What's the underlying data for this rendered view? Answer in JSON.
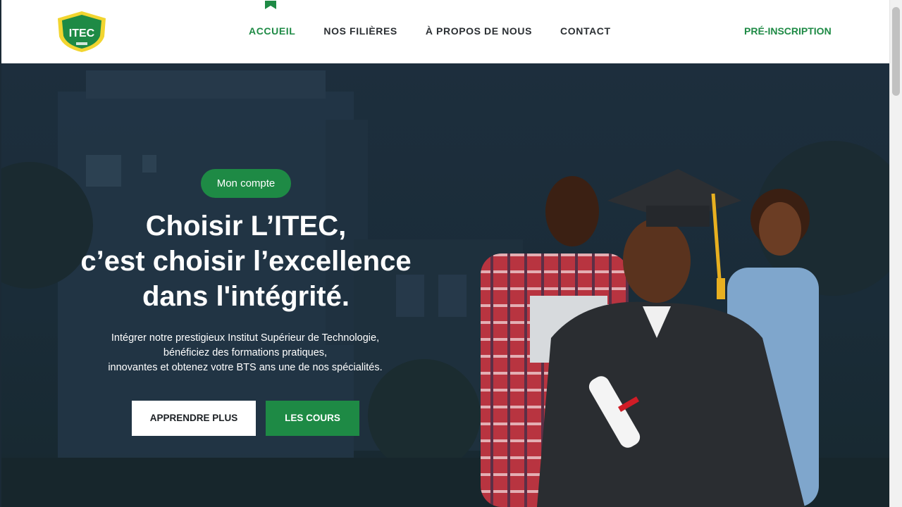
{
  "header": {
    "logo_text": "ITEC",
    "nav": [
      {
        "label": "ACCUEIL",
        "active": true
      },
      {
        "label": "NOS FILIÈRES",
        "active": false
      },
      {
        "label": "À PROPOS DE NOUS",
        "active": false
      },
      {
        "label": "CONTACT",
        "active": false
      }
    ],
    "preinscription_label": "PRÉ-INSCRIPTION"
  },
  "hero": {
    "account_button": "Mon compte",
    "headline": [
      "Choisir L’ITEC,",
      "c’est choisir l’excellence",
      "dans l'intégrité."
    ],
    "subtext": [
      "Intégrer notre prestigieux Institut Supérieur de Technologie,",
      "bénéficiez des formations pratiques,",
      "innovantes et obtenez votre BTS ans une de nos spécialités."
    ],
    "primary_button": "APPRENDRE PLUS",
    "secondary_button": "LES COURS"
  },
  "colors": {
    "accent_green": "#1e8a45",
    "logo_yellow": "#f2d530",
    "hero_overlay": "#1d2e3d",
    "nav_text": "#2b2f33"
  },
  "icons": {
    "logo": "shield-logo",
    "nav_marker": "bookmark-icon"
  }
}
